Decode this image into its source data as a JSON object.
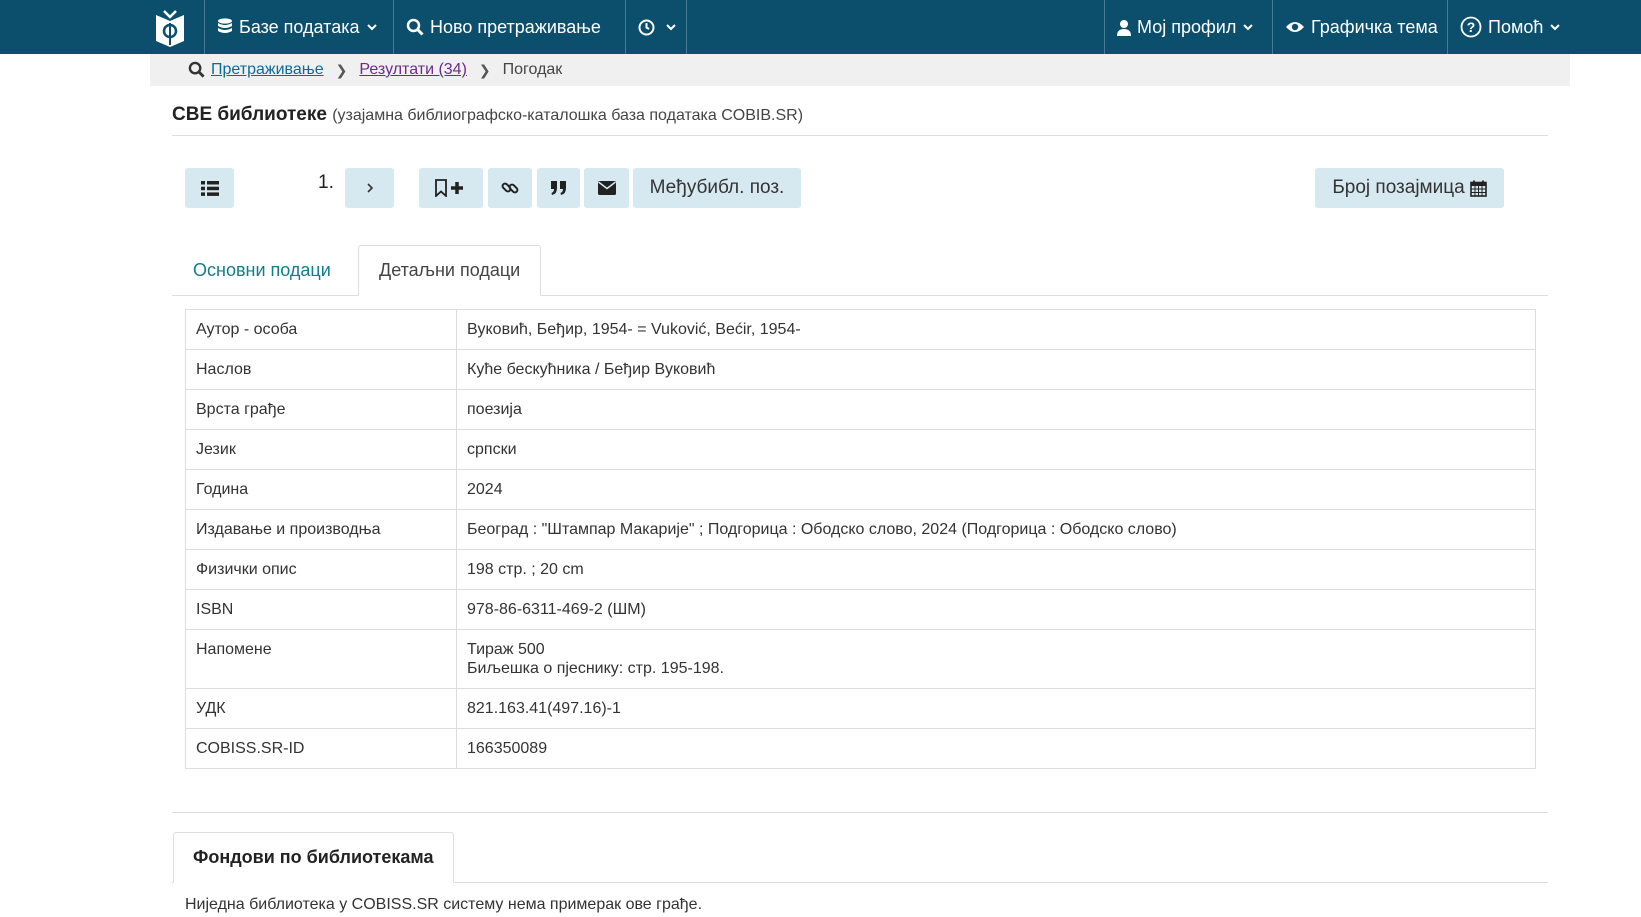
{
  "navbar": {
    "logo_name": "cobiss-logo",
    "databases_label": "Базе података",
    "new_search_label": "Ново претраживање",
    "profile_label": "Мој профил",
    "theme_label": "Графичка тема",
    "help_label": "Помоћ"
  },
  "breadcrumb": {
    "search_link": "Претраживање",
    "results_link": "Резултати (34)",
    "current": "Погодак"
  },
  "database": {
    "title": "СВЕ библиотеке",
    "subtitle": "(узајамна библиографско-каталошка база података COBIB.SR)"
  },
  "toolbar": {
    "hit_number": "1.",
    "interlibrary_label": "Међубибл. поз.",
    "loans_label": "Број позајмица"
  },
  "tabs": {
    "basic": "Основни подаци",
    "detailed": "Детаљни подаци"
  },
  "details": [
    {
      "key": "Аутор - особа",
      "value": "Вуковић, Беђир, 1954- = Vuković, Bećir, 1954-"
    },
    {
      "key": "Наслов",
      "value": "Куће бескућника / Беђир Вуковић"
    },
    {
      "key": "Врста грађе",
      "value": "поезија"
    },
    {
      "key": "Језик",
      "value": "српски"
    },
    {
      "key": "Година",
      "value": "2024"
    },
    {
      "key": "Издавање и производња",
      "value": "Београд : \"Штампар Макарије\" ; Подгорица : Ободско слово, 2024 (Подгорица : Ободско слово)"
    },
    {
      "key": "Физички опис",
      "value": "198 стр. ; 20 cm"
    },
    {
      "key": "ISBN",
      "value": "978-86-6311-469-2 (ШМ)"
    },
    {
      "key": "Напомене",
      "value": "Тираж 500",
      "value2": "Биљешка о пјеснику: стр. 195-198."
    },
    {
      "key": "УДК",
      "value": "821.163.41(497.16)-1"
    },
    {
      "key": "COBISS.SR-ID",
      "value": "166350089"
    }
  ],
  "holdings": {
    "tab_label": "Фондови по библиотекама",
    "message": "Ниједна библиотека у COBISS.SR систему нема примерак ове грађе."
  },
  "colors": {
    "navbar": "#0b4f6c",
    "button": "#d6e8f0",
    "link": "#0b6b9c",
    "tab_link": "#137c8c"
  }
}
